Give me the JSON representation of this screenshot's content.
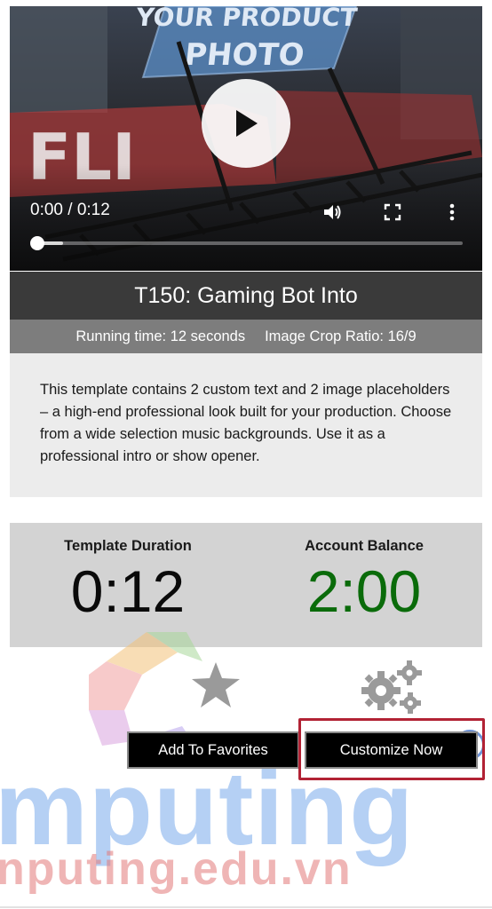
{
  "player": {
    "time_display": "0:00 / 0:12",
    "progress_fraction": 0.0,
    "controls": {
      "play": "play-icon",
      "volume": "volume-icon",
      "fullscreen": "fullscreen-icon",
      "more": "more-vert-icon"
    },
    "thumbnail_text": [
      "YOUR PRODUCT",
      "PHOTO"
    ]
  },
  "template": {
    "title": "T150: Gaming Bot Into",
    "running_time": "Running time: 12 seconds",
    "crop_ratio": "Image Crop Ratio: 16/9",
    "description": "This template contains 2 custom text and 2 image placeholders – a high-end professional look built for your production. Choose from a wide selection music backgrounds. Use it as a professional intro or show opener."
  },
  "stats": {
    "duration_label": "Template Duration",
    "duration_value": "0:12",
    "balance_label": "Account Balance",
    "balance_value": "2:00"
  },
  "actions": {
    "favorites_label": "Add To Favorites",
    "customize_label": "Customize Now"
  },
  "watermark": {
    "line1": "mputing",
    "line2": "nputing.edu.vn",
    "registered": "R"
  },
  "colors": {
    "balance": "#0a6b0a",
    "highlight_border": "#b22234",
    "title_bar": "#3a3a3a",
    "meta_bar": "#7d7d7d"
  }
}
